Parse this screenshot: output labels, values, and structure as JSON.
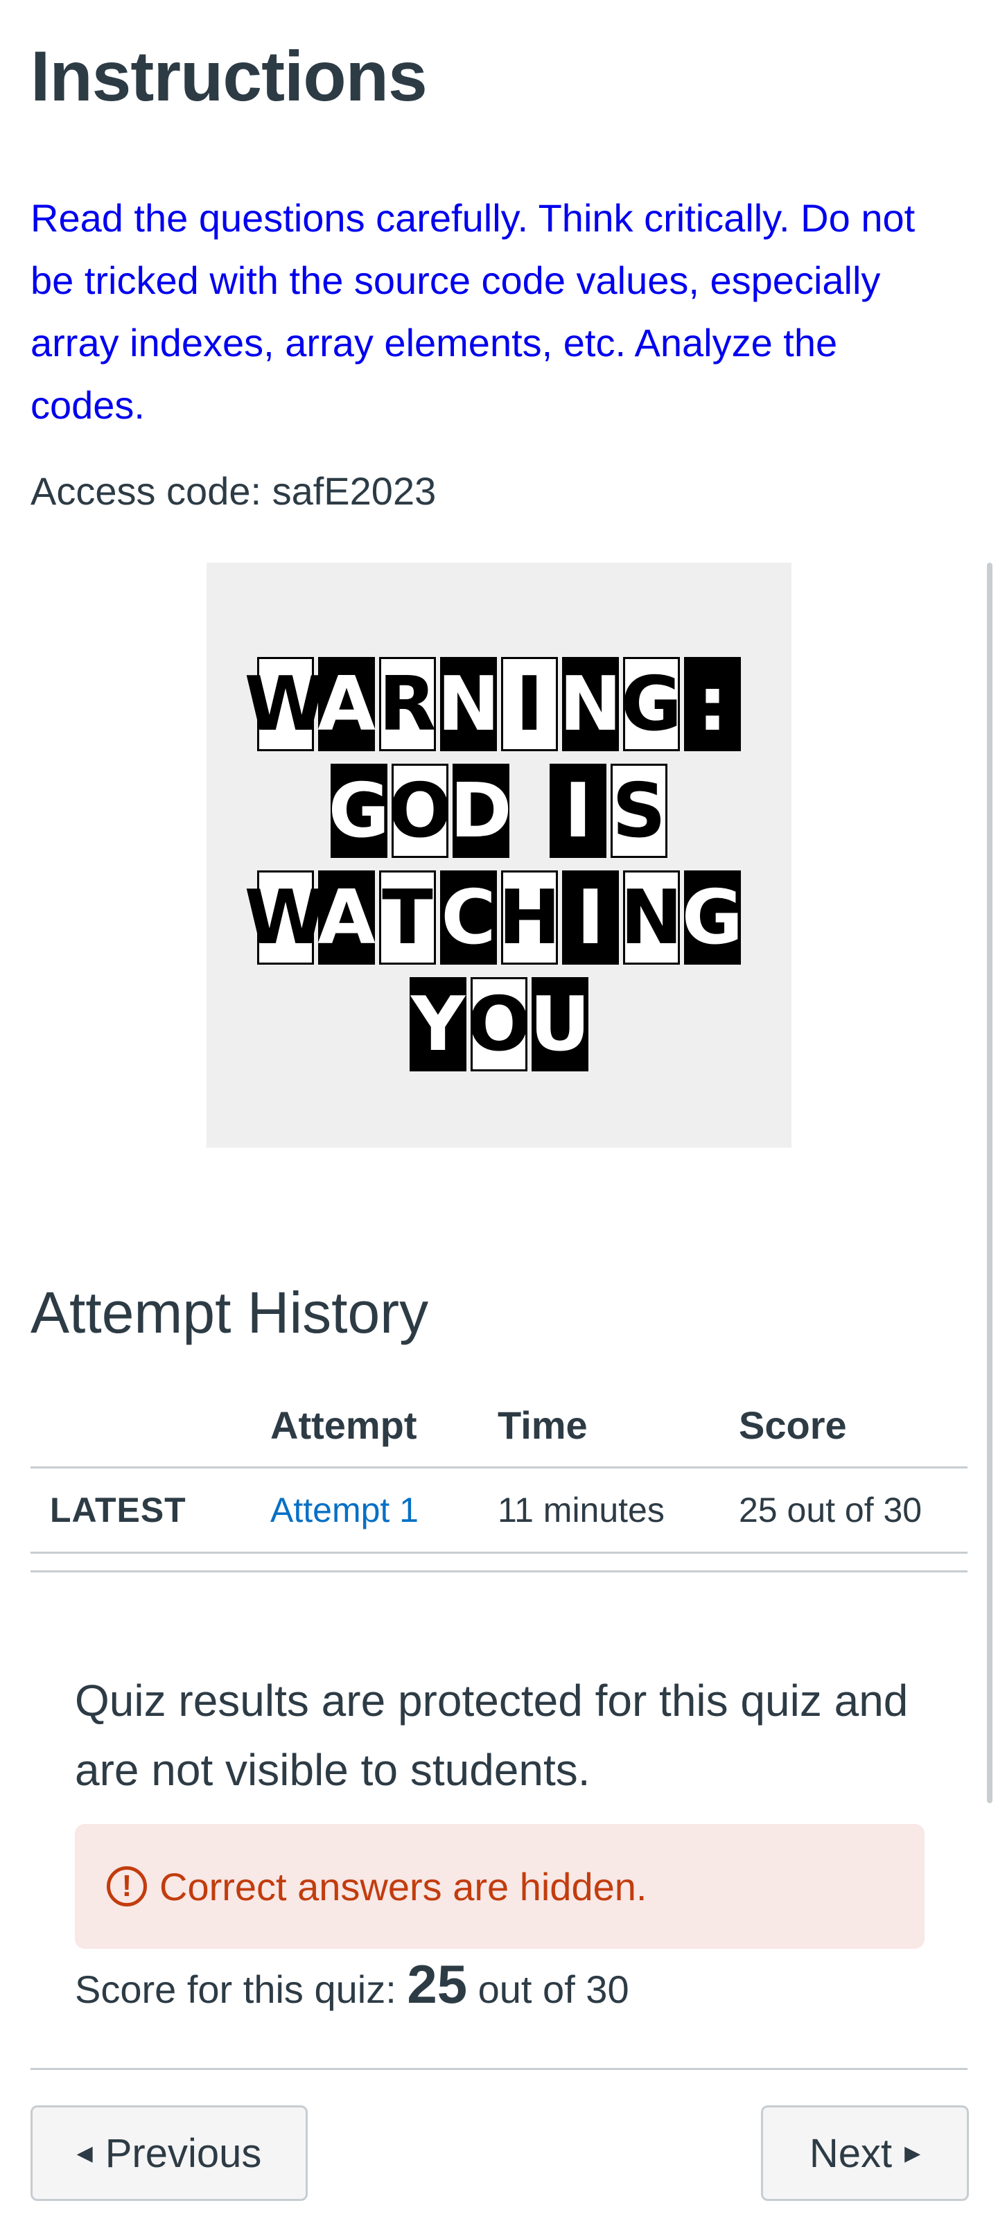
{
  "page": {
    "title": "Instructions",
    "instructions_text": "Read the questions carefully. Think critically. Do not be tricked with the source code values, especially array indexes, array elements, etc. Analyze the codes.",
    "access_code_text": "Access code: safE2023"
  },
  "warning_image": {
    "lines": [
      "WARNING:",
      "GOD IS",
      "WATCHING",
      "YOU"
    ]
  },
  "attempt_history": {
    "title": "Attempt History",
    "columns": [
      "Attempt",
      "Time",
      "Score"
    ],
    "rows": [
      {
        "label": "LATEST",
        "attempt": "Attempt 1",
        "time": "11 minutes",
        "score": "25 out of 30"
      }
    ]
  },
  "results": {
    "protected_text": "Quiz results are protected for this quiz and are not visible to students.",
    "alert_text": "Correct answers are hidden.",
    "score_prefix": "Score for this quiz:",
    "score_value": "25",
    "score_suffix": "out of 30"
  },
  "navigation": {
    "previous_label": "Previous",
    "next_label": "Next"
  },
  "colors": {
    "text": "#2d3b45",
    "instructions": "#0000ee",
    "link": "#0770c5",
    "alert_bg": "#f8e8e6",
    "alert_text": "#c23c0d"
  }
}
